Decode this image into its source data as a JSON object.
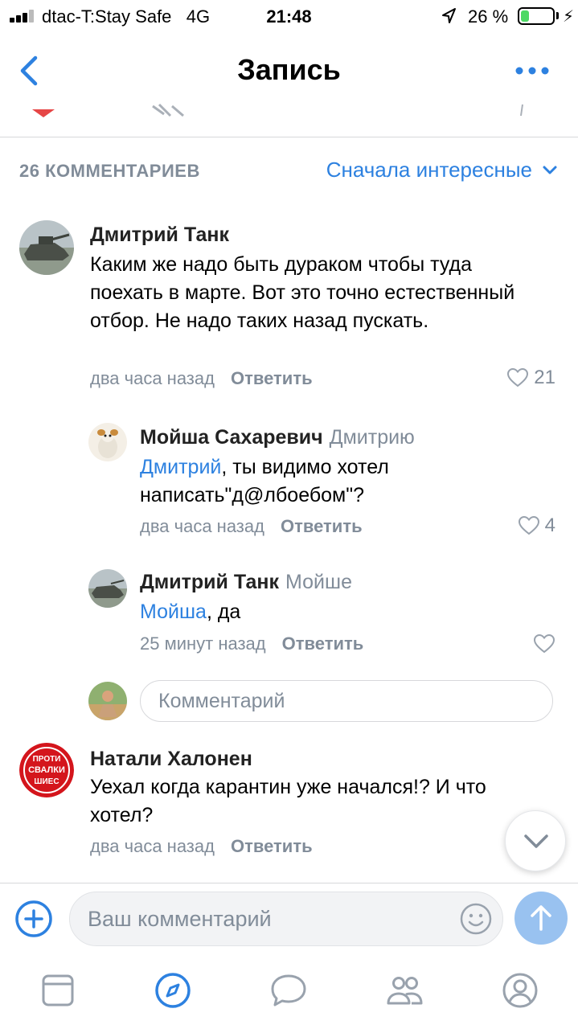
{
  "status_bar": {
    "carrier": "dtac-T:Stay Safe",
    "network": "4G",
    "time": "21:48",
    "battery": "26 %",
    "battery_level": 0.26,
    "battery_color": "#4cd964"
  },
  "nav": {
    "title": "Запись",
    "back_icon": "chevron-left-icon",
    "more_icon": "more-dots-icon",
    "accent": "#2d81e0"
  },
  "comments_header": {
    "count_label": "26 КОММЕНТАРИЕВ",
    "sort_label": "Сначала интересные"
  },
  "comments": [
    {
      "author": "Дмитрий Танк",
      "text": "Каким же надо быть дураком чтобы туда поехать в марте. Вот это точно естественный отбор. Не надо таких назад пускать.",
      "time": "два часа назад",
      "reply_label": "Ответить",
      "likes": "21"
    },
    {
      "author": "Мойша Сахаревич",
      "reply_to": "Дмитрию",
      "mention": "Дмитрий",
      "text": ", ты видимо хотел написать\"д@лбоебом\"?",
      "time": "два часа назад",
      "reply_label": "Ответить",
      "likes": "4"
    },
    {
      "author": "Дмитрий Танк",
      "reply_to": "Мойше",
      "mention": "Мойша",
      "text": ", да",
      "time": "25 минут назад",
      "reply_label": "Ответить"
    },
    {
      "author": "Натали Халонен",
      "text": "Уехал когда карантин уже начался!? И что хотел?",
      "time": "два часа назад",
      "reply_label": "Ответить",
      "avatar_text": [
        "ПРОТИ",
        "СВАЛКИ",
        "ШИЕС"
      ]
    }
  ],
  "inline_reply": {
    "placeholder": "Комментарий"
  },
  "composer": {
    "placeholder": "Ваш комментарий"
  },
  "tabbar": [
    "feed-icon",
    "discover-compass-icon",
    "messages-icon",
    "friends-icon",
    "profile-icon"
  ]
}
